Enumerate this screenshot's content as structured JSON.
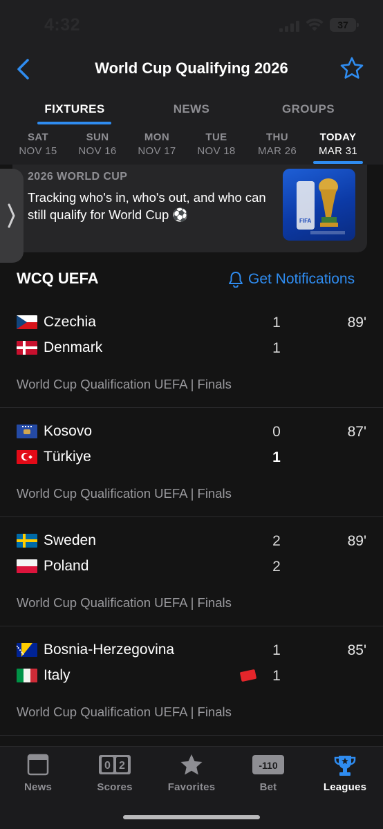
{
  "status": {
    "time": "4:32",
    "battery": "37"
  },
  "header": {
    "title": "World Cup Qualifying 2026"
  },
  "tabs": [
    {
      "label": "FIXTURES"
    },
    {
      "label": "NEWS"
    },
    {
      "label": "GROUPS"
    }
  ],
  "dates": [
    {
      "dow": "SAT",
      "md": "NOV 15"
    },
    {
      "dow": "SUN",
      "md": "NOV 16"
    },
    {
      "dow": "MON",
      "md": "NOV 17"
    },
    {
      "dow": "TUE",
      "md": "NOV 18"
    },
    {
      "dow": "THU",
      "md": "MAR 26"
    },
    {
      "dow": "TODAY",
      "md": "MAR 31"
    }
  ],
  "promo": {
    "eyebrow": "2026 WORLD CUP",
    "text": "Tracking who's in, who's out, and who can still qualify for World Cup ⚽",
    "image_label": "FIFA"
  },
  "section": {
    "title": "WCQ UEFA",
    "notifications": "Get Notifications"
  },
  "matches": [
    {
      "home": "Czechia",
      "home_score": "1",
      "away": "Denmark",
      "away_score": "1",
      "minute": "89'",
      "competition": "World Cup Qualification UEFA | Finals"
    },
    {
      "home": "Kosovo",
      "home_score": "0",
      "away": "Türkiye",
      "away_score": "1",
      "minute": "87'",
      "competition": "World Cup Qualification UEFA | Finals"
    },
    {
      "home": "Sweden",
      "home_score": "2",
      "away": "Poland",
      "away_score": "2",
      "minute": "89'",
      "competition": "World Cup Qualification UEFA | Finals"
    },
    {
      "home": "Bosnia-Herzegovina",
      "home_score": "1",
      "away": "Italy",
      "away_score": "1",
      "minute": "85'",
      "competition": "World Cup Qualification UEFA | Finals"
    }
  ],
  "tabbar": {
    "news": "News",
    "scores": "Scores",
    "scores_icon_a": "0",
    "scores_icon_b": "2",
    "favorites": "Favorites",
    "bet": "Bet",
    "bet_icon": "-110",
    "leagues": "Leagues"
  },
  "colors": {
    "accent": "#2f8cf0",
    "background": "#141414",
    "header": "#1f1f21",
    "red_card": "#e5262b"
  }
}
